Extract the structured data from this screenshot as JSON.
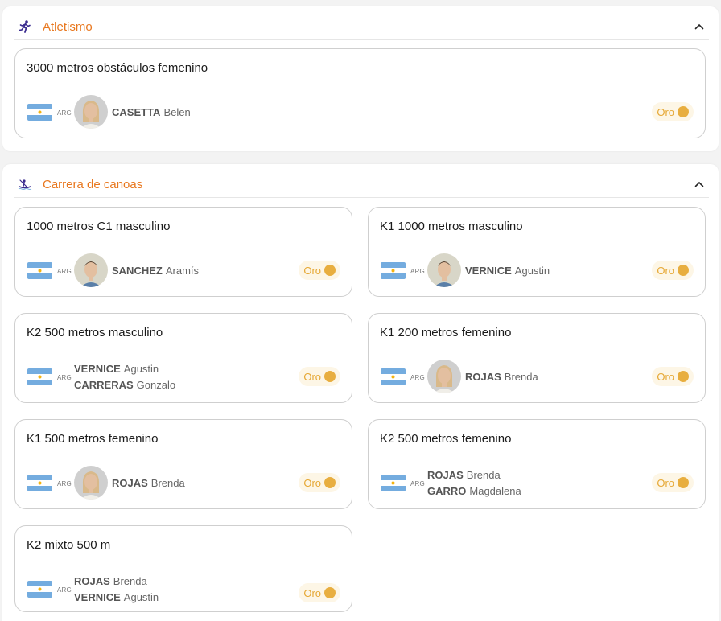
{
  "sections": {
    "atletismo": {
      "title": "Atletismo",
      "icon": "running-person-icon",
      "events": [
        {
          "title": "3000 metros obstáculos femenino",
          "country": "ARG",
          "athletes": [
            {
              "last": "CASETTA",
              "first": "Belen"
            }
          ],
          "medal": "Oro"
        }
      ]
    },
    "canoas": {
      "title": "Carrera de canoas",
      "icon": "canoe-icon",
      "events": [
        {
          "title": "1000 metros C1 masculino",
          "country": "ARG",
          "athletes": [
            {
              "last": "SANCHEZ",
              "first": "Aramís"
            }
          ],
          "medal": "Oro"
        },
        {
          "title": "K1 1000 metros masculino",
          "country": "ARG",
          "athletes": [
            {
              "last": "VERNICE",
              "first": "Agustin"
            }
          ],
          "medal": "Oro"
        },
        {
          "title": "K2 500 metros masculino",
          "country": "ARG",
          "athletes": [
            {
              "last": "VERNICE",
              "first": "Agustin"
            },
            {
              "last": "CARRERAS",
              "first": "Gonzalo"
            }
          ],
          "medal": "Oro"
        },
        {
          "title": "K1 200 metros femenino",
          "country": "ARG",
          "athletes": [
            {
              "last": "ROJAS",
              "first": "Brenda"
            }
          ],
          "medal": "Oro"
        },
        {
          "title": "K1 500 metros femenino",
          "country": "ARG",
          "athletes": [
            {
              "last": "ROJAS",
              "first": "Brenda"
            }
          ],
          "medal": "Oro"
        },
        {
          "title": "K2 500 metros femenino",
          "country": "ARG",
          "athletes": [
            {
              "last": "ROJAS",
              "first": "Brenda"
            },
            {
              "last": "GARRO",
              "first": "Magdalena"
            }
          ],
          "medal": "Oro"
        },
        {
          "title": "K2 mixto 500 m",
          "country": "ARG",
          "athletes": [
            {
              "last": "ROJAS",
              "first": "Brenda"
            },
            {
              "last": "VERNICE",
              "first": "Agustin"
            }
          ],
          "medal": "Oro"
        }
      ]
    }
  },
  "colors": {
    "accent": "#e8771e",
    "gold": "#e8ae3f",
    "flag_blue": "#74acdf",
    "flag_sun": "#f6b40e"
  }
}
